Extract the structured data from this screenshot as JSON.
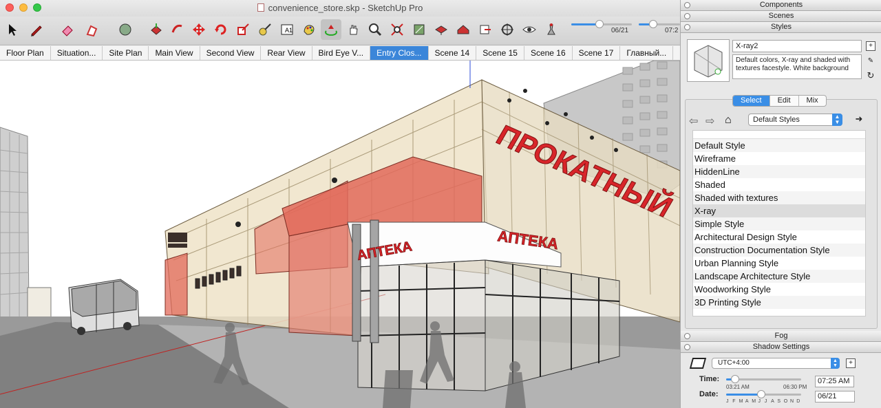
{
  "window": {
    "title": "convenience_store.skp - SketchUp Pro"
  },
  "toolbar": {
    "tools": [
      "select-icon",
      "pencil-icon",
      "eraser-icon",
      "paint-bucket-icon",
      "shapes-icon",
      "push-pull-icon",
      "follow-me-icon",
      "move-icon",
      "rotate-icon",
      "scale-icon",
      "tape-measure-icon",
      "text-label-icon",
      "paint-icon",
      "orbit-icon",
      "pan-icon",
      "zoom-icon",
      "zoom-extents-icon",
      "section-plane-icon",
      "components-icon",
      "warehouse-icon",
      "export-icon",
      "position-camera-icon",
      "look-around-icon",
      "walk-icon"
    ],
    "shadow_date": "06/21",
    "shadow_time": "07:2",
    "date_slider_fraction": 0.47,
    "time_slider_fraction": 0.35
  },
  "scene_tabs": [
    {
      "label": "Floor Plan",
      "active": false
    },
    {
      "label": "Situation...",
      "active": false
    },
    {
      "label": "Site Plan",
      "active": false
    },
    {
      "label": "Main View",
      "active": false
    },
    {
      "label": "Second View",
      "active": false
    },
    {
      "label": "Rear View",
      "active": false
    },
    {
      "label": "Bird Eye V...",
      "active": false
    },
    {
      "label": "Entry Clos...",
      "active": true
    },
    {
      "label": "Scene 14",
      "active": false
    },
    {
      "label": "Scene 15",
      "active": false
    },
    {
      "label": "Scene 16",
      "active": false
    },
    {
      "label": "Scene 17",
      "active": false
    },
    {
      "label": "Главный...",
      "active": false
    }
  ],
  "viewport": {
    "sign_main": "ПРОКАТНЫЙ",
    "sign_pharmacy": "АПТЕКА",
    "sign_pharmacy_side": "АПТЕКА"
  },
  "tray": {
    "components_title": "Components",
    "scenes_title": "Scenes",
    "styles_title": "Styles",
    "fog_title": "Fog",
    "shadow_title": "Shadow Settings",
    "style_name": "X-ray2",
    "style_description": "Default colors, X-ray and shaded with textures facestyle. White background",
    "style_tabs": [
      {
        "label": "Select",
        "active": true
      },
      {
        "label": "Edit",
        "active": false
      },
      {
        "label": "Mix",
        "active": false
      }
    ],
    "library": "Default Styles",
    "styles": [
      {
        "label": "Default Style",
        "selected": false
      },
      {
        "label": "Wireframe",
        "selected": false
      },
      {
        "label": "HiddenLine",
        "selected": false
      },
      {
        "label": "Shaded",
        "selected": false
      },
      {
        "label": "Shaded with textures",
        "selected": false
      },
      {
        "label": "X-ray",
        "selected": true
      },
      {
        "label": "Simple Style",
        "selected": false
      },
      {
        "label": "Architectural Design Style",
        "selected": false
      },
      {
        "label": "Construction Documentation Style",
        "selected": false
      },
      {
        "label": "Urban Planning Style",
        "selected": false
      },
      {
        "label": "Landscape Architecture Style",
        "selected": false
      },
      {
        "label": "Woodworking Style",
        "selected": false
      },
      {
        "label": "3D Printing Style",
        "selected": false
      }
    ],
    "shadow": {
      "timezone": "UTC+4:00",
      "time_label": "Time:",
      "date_label": "Date:",
      "sunrise": "03:21 AM",
      "sunset": "06:30 PM",
      "time_value": "07:25 AM",
      "date_value": "06/21",
      "months": [
        "J",
        "F",
        "M",
        "A",
        "M",
        "J",
        "J",
        "A",
        "S",
        "O",
        "N",
        "D"
      ],
      "time_fraction": 0.12,
      "date_fraction": 0.47
    }
  },
  "colors": {
    "accent": "#3a8ee6",
    "sign_red": "#d8252a",
    "facade_red": "#e26a5a",
    "axis_blue": "#2b4bd9",
    "axis_red": "#c0211f"
  }
}
